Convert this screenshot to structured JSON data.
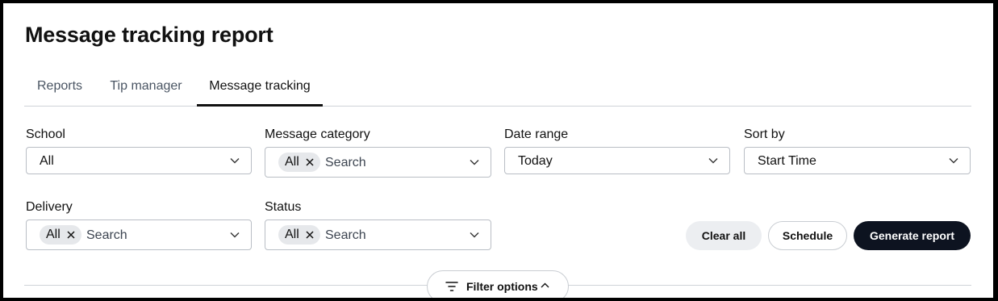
{
  "page": {
    "title": "Message tracking report"
  },
  "tabs": [
    {
      "label": "Reports"
    },
    {
      "label": "Tip manager"
    },
    {
      "label": "Message tracking",
      "active": true
    }
  ],
  "filters": {
    "school": {
      "label": "School",
      "value": "All"
    },
    "message_category": {
      "label": "Message category",
      "chip": "All",
      "placeholder": "Search"
    },
    "date_range": {
      "label": "Date range",
      "value": "Today"
    },
    "sort_by": {
      "label": "Sort by",
      "value": "Start Time"
    },
    "delivery": {
      "label": "Delivery",
      "chip": "All",
      "placeholder": "Search"
    },
    "status": {
      "label": "Status",
      "chip": "All",
      "placeholder": "Search"
    }
  },
  "actions": {
    "clear_all": "Clear all",
    "schedule": "Schedule",
    "generate_report": "Generate report"
  },
  "filter_options": {
    "label": "Filter options"
  },
  "icons": {
    "chevron": "chevron-down-icon",
    "remove": "close-icon",
    "filter": "filter-lines-icon",
    "collapse": "chevron-up-icon"
  },
  "colors": {
    "primary_button": "#0d1320",
    "chip_bg": "#e6e8eb",
    "border": "#b9bec5"
  }
}
